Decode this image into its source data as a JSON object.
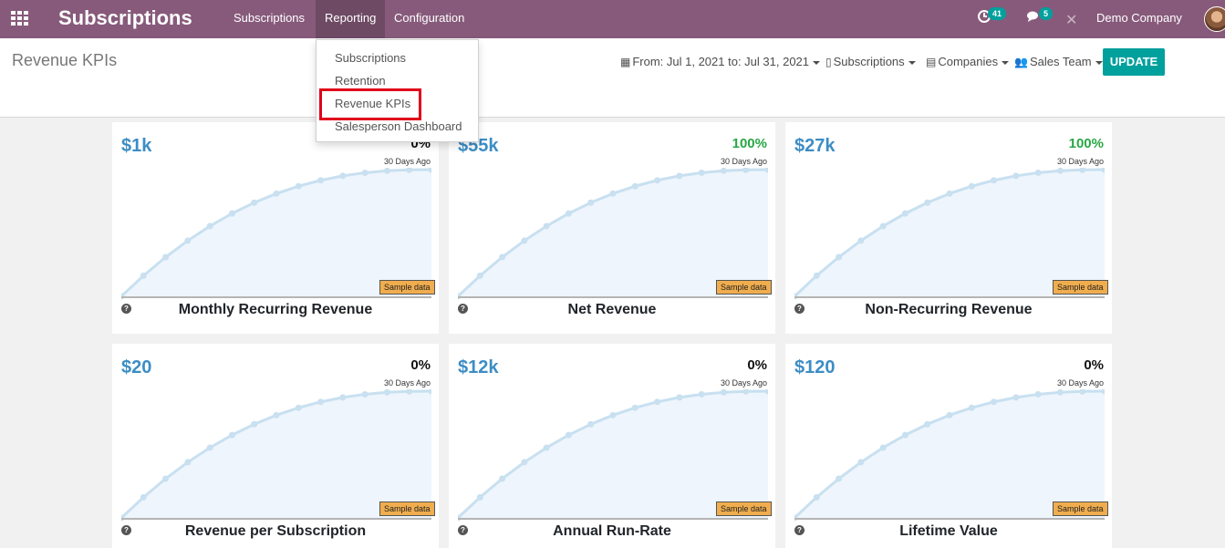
{
  "navbar": {
    "app_name": "Subscriptions",
    "menus": [
      "Subscriptions",
      "Reporting",
      "Configuration"
    ],
    "activity_count": "41",
    "message_count": "5",
    "company": "Demo Company"
  },
  "control_panel": {
    "title": "Revenue KPIs",
    "date_filter": "From: Jul 1, 2021 to: Jul 31, 2021",
    "filters": [
      "Subscriptions",
      "Companies",
      "Sales Team"
    ],
    "update_label": "UPDATE"
  },
  "reporting_menu": [
    "Subscriptions",
    "Retention",
    "Revenue KPIs",
    "Salesperson Dashboard"
  ],
  "kpis": [
    {
      "value": "$1k",
      "change": "0%",
      "since": "30 Days Ago",
      "name": "Monthly Recurring Revenue",
      "sample_label": "Sample data"
    },
    {
      "value": "$55k",
      "change": "100%",
      "since": "30 Days Ago",
      "name": "Net Revenue",
      "sample_label": "Sample data"
    },
    {
      "value": "$27k",
      "change": "100%",
      "since": "30 Days Ago",
      "name": "Non-Recurring Revenue",
      "sample_label": "Sample data"
    },
    {
      "value": "$20",
      "change": "0%",
      "since": "30 Days Ago",
      "name": "Revenue per Subscription",
      "sample_label": "Sample data"
    },
    {
      "value": "$12k",
      "change": "0%",
      "since": "30 Days Ago",
      "name": "Annual Run-Rate",
      "sample_label": "Sample data"
    },
    {
      "value": "$120",
      "change": "0%",
      "since": "30 Days Ago",
      "name": "Lifetime Value",
      "sample_label": "Sample data"
    }
  ],
  "colors": {
    "brand": "#875a7b",
    "accent": "#00a09d",
    "kpi_value": "#3c8dc5",
    "positive": "#28a745",
    "highlight": "#e0001a"
  }
}
